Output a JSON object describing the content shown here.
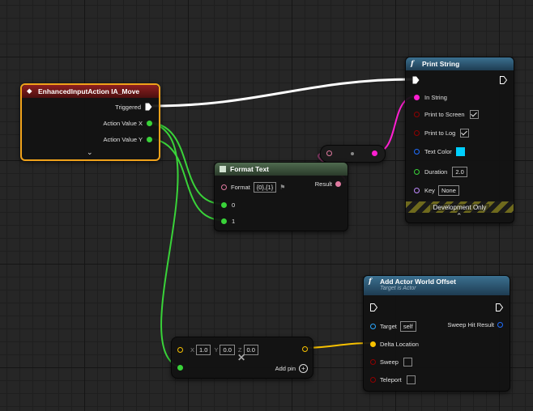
{
  "nodes": {
    "input_action": {
      "title": "EnhancedInputAction IA_Move",
      "pins": {
        "triggered": "Triggered",
        "action_x": "Action Value X",
        "action_y": "Action Value Y"
      },
      "expand_icon": "chevron-down-icon"
    },
    "print_string": {
      "title": "Print String",
      "pins": {
        "in_string": "In String",
        "print_to_screen": "Print to Screen",
        "print_to_log": "Print to Log",
        "text_color": "Text Color",
        "duration": "Duration",
        "key": "Key"
      },
      "values": {
        "print_to_screen": true,
        "print_to_log": true,
        "text_color": "#00cfff",
        "duration": "2.0",
        "key": "None"
      },
      "footer": "Development Only"
    },
    "format_text": {
      "title": "Format Text",
      "pins": {
        "format": "Format",
        "result": "Result",
        "arg0": "0",
        "arg1": "1"
      },
      "values": {
        "format": "{0},{1}"
      }
    },
    "add_actor_offset": {
      "title": "Add Actor World Offset",
      "subtitle": "Target is Actor",
      "pins": {
        "target": "Target",
        "sweep_hit_result": "Sweep Hit Result",
        "delta_location": "Delta Location",
        "sweep": "Sweep",
        "teleport": "Teleport"
      },
      "values": {
        "target": "self",
        "sweep": false,
        "teleport": false
      }
    },
    "make_vector": {
      "labels": {
        "x": "X",
        "y": "Y",
        "z": "Z"
      },
      "values": {
        "x": "1.0",
        "y": "0.0",
        "z": "0.0"
      },
      "add_pin": "Add pin"
    }
  },
  "colors": {
    "exec": "#ffffff",
    "float": "#39d339",
    "string": "#ff1fd1",
    "text": "#e07aa0",
    "vector": "#f7c100",
    "object": "#2aa8ff",
    "bool": "#8f0000",
    "color_struct": "#1f6dff",
    "name": "#c08bff",
    "event_header": "#7a1818",
    "function_header": "#2b5673",
    "pure_header": "#3a5a3a"
  }
}
